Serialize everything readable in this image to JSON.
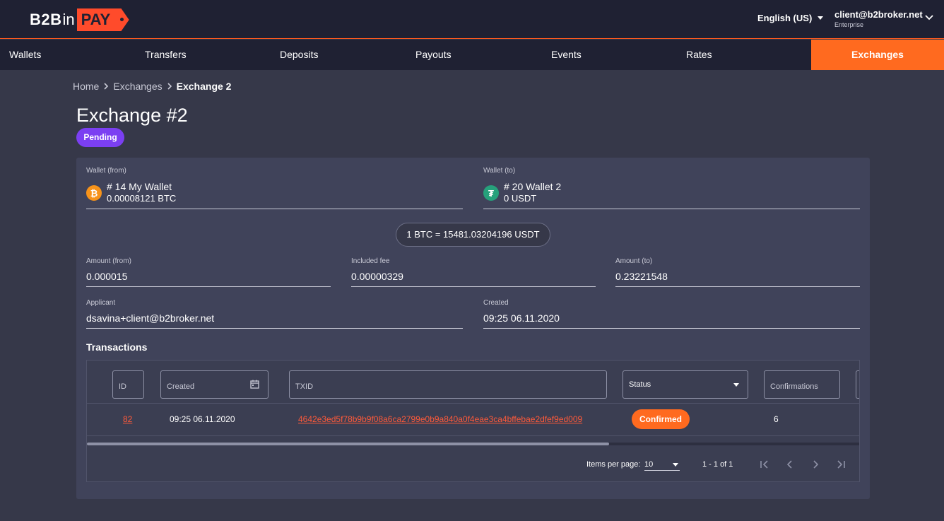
{
  "header": {
    "logo": {
      "b2b": "B2B",
      "in": "in",
      "pay": "PAY"
    },
    "language": "English (US)",
    "user_email": "client@b2broker.net",
    "user_role": "Enterprise"
  },
  "nav": {
    "items": [
      {
        "label": "Wallets"
      },
      {
        "label": "Transfers"
      },
      {
        "label": "Deposits"
      },
      {
        "label": "Payouts"
      },
      {
        "label": "Events"
      },
      {
        "label": "Rates"
      },
      {
        "label": "Exchanges",
        "active": true
      }
    ]
  },
  "breadcrumb": {
    "home": "Home",
    "section": "Exchanges",
    "current": "Exchange 2"
  },
  "page": {
    "title": "Exchange #2",
    "status": "Pending",
    "status_color": "#7b3ff2"
  },
  "exchange": {
    "wallet_from": {
      "label": "Wallet (from)",
      "name": "# 14 My Wallet",
      "balance": "0.00008121 BTC",
      "icon": "bitcoin-icon"
    },
    "wallet_to": {
      "label": "Wallet (to)",
      "name": "# 20 Wallet 2",
      "balance": "0 USDT",
      "icon": "tether-icon"
    },
    "rate": "1 BTC = 15481.03204196 USDT",
    "amount_from": {
      "label": "Amount (from)",
      "value": "0.000015"
    },
    "included_fee": {
      "label": "Included fee",
      "value": "0.00000329"
    },
    "amount_to": {
      "label": "Amount (to)",
      "value": "0.23221548"
    },
    "applicant": {
      "label": "Applicant",
      "value": "dsavina+client@b2broker.net"
    },
    "created": {
      "label": "Created",
      "value": "09:25 06.11.2020"
    }
  },
  "transactions": {
    "title": "Transactions",
    "filters": {
      "id": "ID",
      "created": "Created",
      "txid": "TXID",
      "status": "Status",
      "confirmations": "Confirmations"
    },
    "rows": [
      {
        "id": "82",
        "created": "09:25 06.11.2020",
        "txid": "4642e3ed5f78b9b9f08a6ca2799e0b9a840a0f4eae3ca4bffebae2dfef9ed009",
        "status": "Confirmed",
        "confirmations": "6"
      }
    ],
    "pagination": {
      "items_per_page_label": "Items per page:",
      "items_per_page": "10",
      "range": "1 - 1 of 1"
    }
  },
  "colors": {
    "accent": "#ff6a1f",
    "header_bg": "#1f2133",
    "page_bg": "#363849",
    "card_bg": "#40435a",
    "link": "#ff5a3a"
  }
}
